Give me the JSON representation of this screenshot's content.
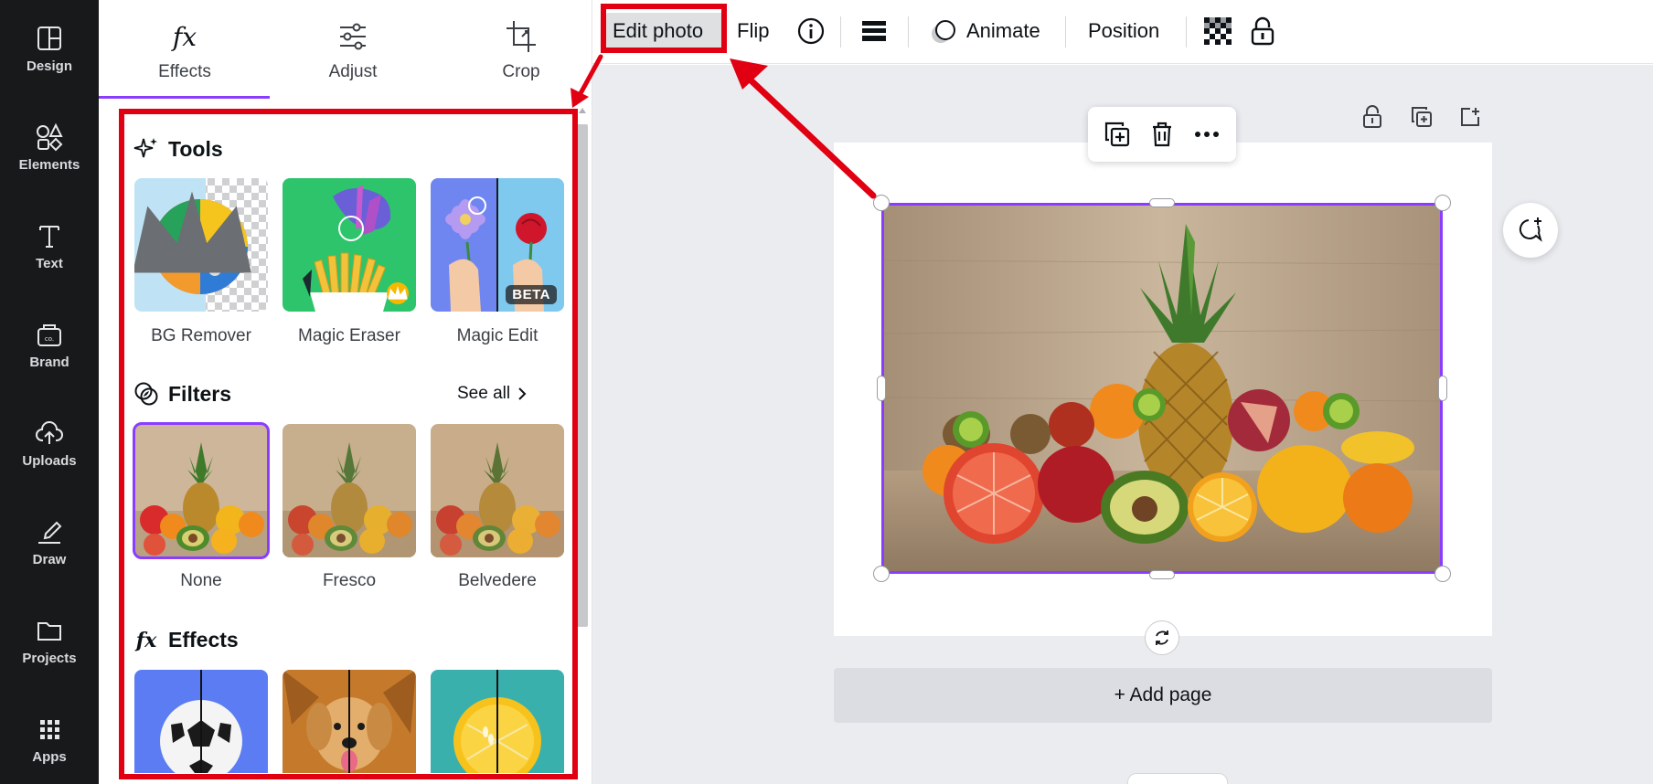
{
  "rail": {
    "items": [
      {
        "label": "Design",
        "icon": "layout-icon"
      },
      {
        "label": "Elements",
        "icon": "shapes-icon"
      },
      {
        "label": "Text",
        "icon": "text-icon"
      },
      {
        "label": "Brand",
        "icon": "brand-icon"
      },
      {
        "label": "Uploads",
        "icon": "cloud-upload-icon"
      },
      {
        "label": "Draw",
        "icon": "pen-icon"
      },
      {
        "label": "Projects",
        "icon": "folder-icon"
      },
      {
        "label": "Apps",
        "icon": "grid-icon"
      }
    ]
  },
  "panel": {
    "tabs": [
      {
        "label": "Effects",
        "icon": "fx-icon",
        "active": true
      },
      {
        "label": "Adjust",
        "icon": "sliders-icon",
        "active": false
      },
      {
        "label": "Crop",
        "icon": "crop-icon",
        "active": false
      }
    ],
    "tools": {
      "title": "Tools",
      "items": [
        {
          "label": "BG Remover",
          "badge": ""
        },
        {
          "label": "Magic Eraser",
          "badge": ""
        },
        {
          "label": "Magic Edit",
          "badge": "BETA"
        }
      ]
    },
    "filters": {
      "title": "Filters",
      "see_all": "See all",
      "items": [
        {
          "label": "None",
          "selected": true
        },
        {
          "label": "Fresco",
          "selected": false
        },
        {
          "label": "Belvedere",
          "selected": false
        }
      ]
    },
    "effects": {
      "title": "Effects"
    }
  },
  "toolbar": {
    "edit_photo": "Edit photo",
    "flip": "Flip",
    "animate": "Animate",
    "position": "Position"
  },
  "canvas": {
    "add_page": "+ Add page"
  },
  "colors": {
    "accent": "#8b3dff",
    "annotation": "#e00012",
    "rail_bg": "#18191b",
    "stage_bg": "#ebecf0"
  }
}
